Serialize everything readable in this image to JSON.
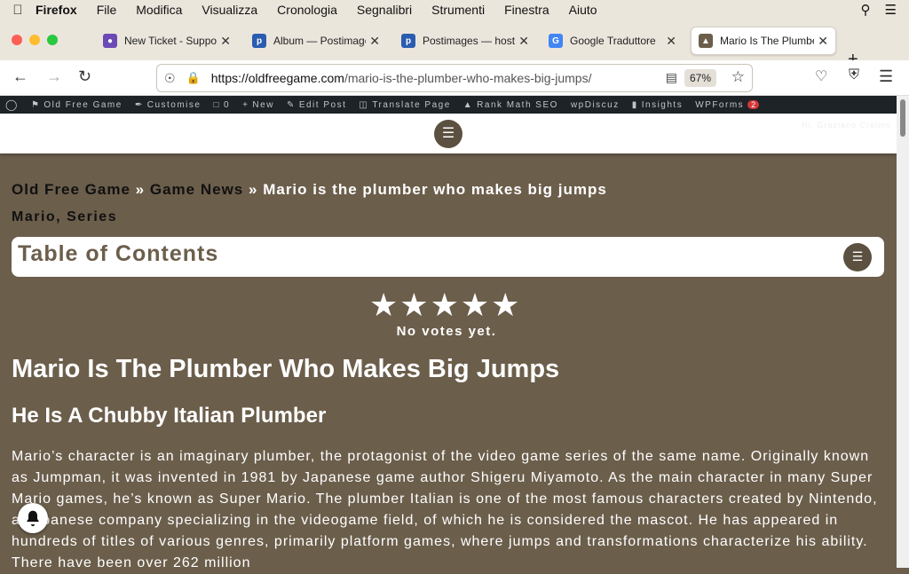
{
  "menubar": {
    "app": "Firefox",
    "items": [
      "File",
      "Modifica",
      "Visualizza",
      "Cronologia",
      "Segnalibri",
      "Strumenti",
      "Finestra",
      "Aiuto"
    ]
  },
  "tabs": [
    {
      "label": "New Ticket - Support",
      "icon": "ticket-icon",
      "color": "#6c4ab6"
    },
    {
      "label": "Album — Postimages",
      "icon": "postimages-icon",
      "color": "#2a5db0"
    },
    {
      "label": "Postimages — hosting",
      "icon": "postimages-icon",
      "color": "#2a5db0"
    },
    {
      "label": "Google Traduttore",
      "icon": "google-translate-icon",
      "color": "#4285f4"
    },
    {
      "label": "Mario Is The Plumber",
      "icon": "site-icon",
      "color": "#6b5e4b"
    }
  ],
  "url": {
    "host": "https://oldfreegame.com",
    "path": "/mario-is-the-plumber-who-makes-big-jumps/"
  },
  "zoom": "67%",
  "wpbar": {
    "items": [
      "Old Free Game",
      "Customise",
      "0",
      "New",
      "Edit Post",
      "Translate Page",
      "Rank Math SEO",
      "wpDiscuz",
      "Insights",
      "WPForms"
    ],
    "forms_badge": "2",
    "greeting": "Hi, Graziano Crelino"
  },
  "breadcrumb": {
    "home": "Old Free Game",
    "sep": "»",
    "section": "Game News",
    "current": "Mario is the plumber who makes big jumps"
  },
  "categories": "Mario, Series",
  "toc_title": "Table of Contents",
  "rating": {
    "stars": 0,
    "max": 5,
    "votes_text": "No votes yet."
  },
  "article": {
    "title": "Mario Is The Plumber Who Makes Big Jumps",
    "subtitle": "He Is A Chubby Italian Plumber",
    "body": "Mario’s character is an imaginary plumber, the protagonist of the video game series of the same name. Originally known as Jumpman, it was invented in 1981 by Japanese game author Shigeru Miyamoto. As the main character in many Super Mario games, he’s known as Super Mario. The plumber Italian is one of the most famous characters created by Nintendo, a Japanese company specializing in the videogame field, of which he is considered the mascot. He has appeared in hundreds of titles of various genres, primarily platform games, where jumps and transformations characterize his ability. There have been over 262 million"
  }
}
